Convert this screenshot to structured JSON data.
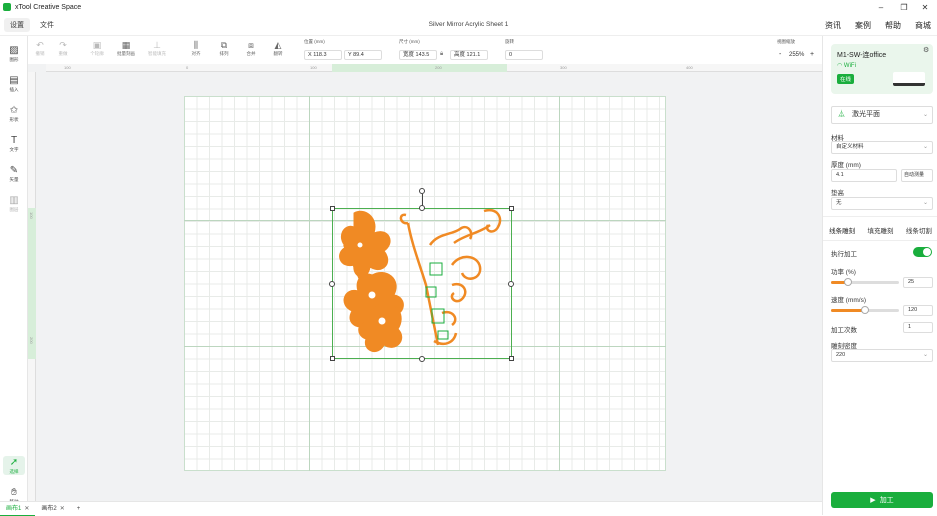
{
  "app": {
    "name": "xTool Creative Space",
    "doc_title": "Silver Mirror Acrylic Sheet 1"
  },
  "window_controls": {
    "minimize": "–",
    "maximize": "❐",
    "close": "✕"
  },
  "menu": {
    "settings": "设置",
    "file": "文件"
  },
  "top_links": [
    "资讯",
    "案例",
    "帮助",
    "商城"
  ],
  "toolbar": {
    "undo": "撤销",
    "redo": "重做",
    "outline": "个轮廓",
    "batch": "批量刻画",
    "smart_fill": "智能填充",
    "align": "对齐",
    "arrange": "排列",
    "combine": "合并",
    "flip": "翻转",
    "position_label": "位置 (mm)",
    "x": "X 118.3",
    "y": "Y 89.4",
    "size_label": "尺寸 (mm)",
    "width": "宽度 143.5",
    "height": "高度 121.1",
    "rotate_label": "旋转",
    "rotate": "0",
    "zoom_label": "视图缩放",
    "zoom": "255%",
    "zoom_minus": "-",
    "zoom_plus": "+"
  },
  "left_panel": [
    "图形",
    "插入",
    "形状",
    "文字",
    "矢量",
    "图层"
  ],
  "left_bottom": [
    "选择",
    "移动"
  ],
  "ruler": {
    "h": [
      "100",
      "0",
      "100",
      "200",
      "300",
      "400"
    ],
    "v": [
      "100",
      "200"
    ]
  },
  "tabs": [
    "画布1",
    "画布2"
  ],
  "add_tab": "+",
  "device": {
    "name": "M1-SW-连office",
    "wifi": "WiFi",
    "status": "在线"
  },
  "right_panel": {
    "mode": "激光平面",
    "material_label": "材料",
    "material": "自定义材料",
    "thickness_label": "厚度 (mm)",
    "thickness": "4.1",
    "auto_measure": "自动测量",
    "pad_label": "垫高",
    "pad": "无",
    "process_tabs": [
      "线条雕刻",
      "填充雕刻",
      "线条切割"
    ],
    "execute_label": "执行加工",
    "power_label": "功率 (%)",
    "power": "25",
    "power_fraction": 0.25,
    "speed_label": "速度 (mm/s)",
    "speed": "120",
    "speed_fraction": 0.5,
    "passes_label": "加工次数",
    "passes": "1",
    "density_label": "雕刻密度",
    "density": "220",
    "process_button": "加工"
  },
  "colors": {
    "accent": "#1aae3d",
    "design": "#f08a24",
    "selection": "#4caf50"
  }
}
